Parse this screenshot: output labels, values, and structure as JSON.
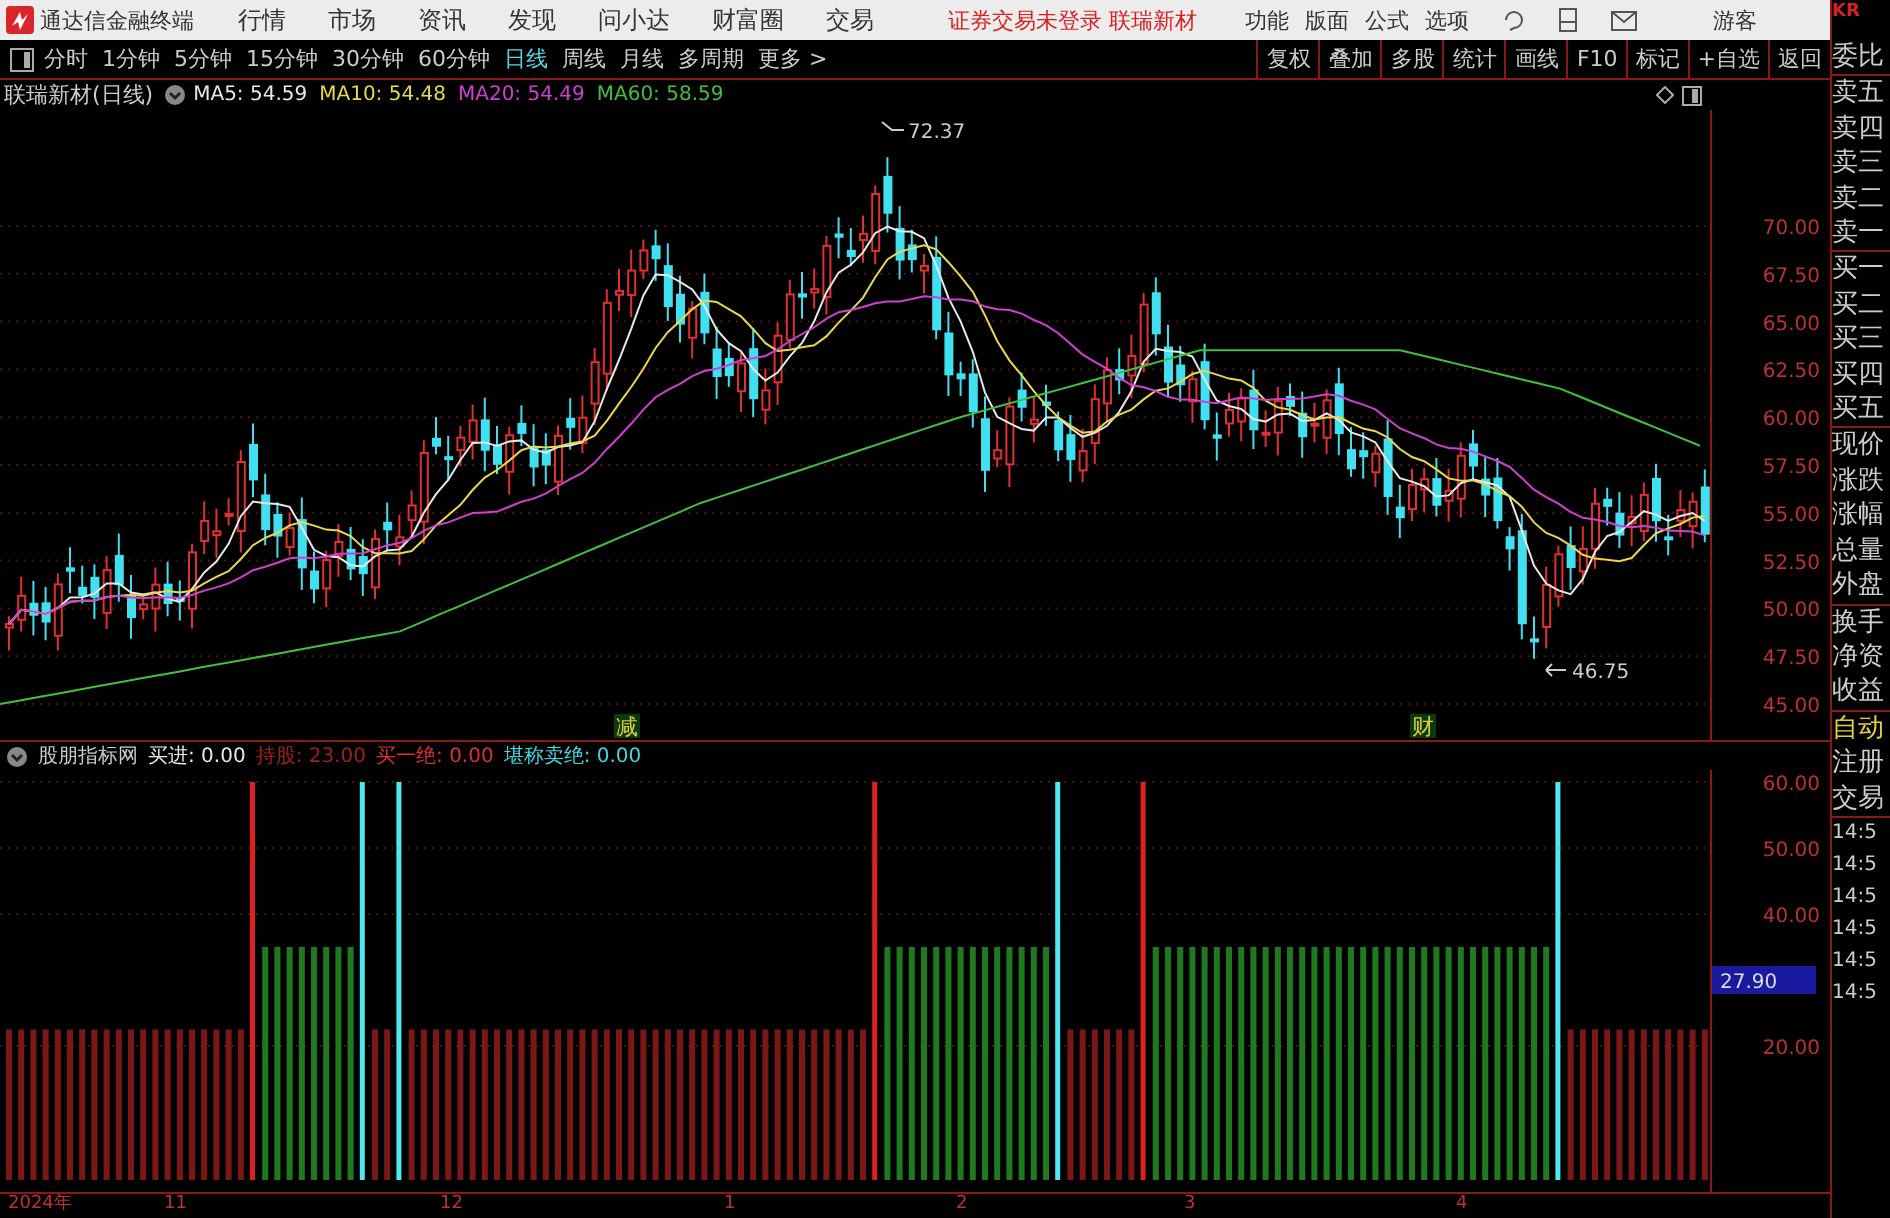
{
  "app": {
    "title": "通达信金融终端",
    "menu": [
      "行情",
      "市场",
      "资讯",
      "发现",
      "问小达",
      "财富圈",
      "交易"
    ],
    "notice": "证券交易未登录 联瑞新材",
    "tools": [
      "功能",
      "版面",
      "公式",
      "选项"
    ],
    "user": "游客"
  },
  "toolbar": {
    "periods": [
      {
        "label": "分时",
        "selected": false
      },
      {
        "label": "1分钟",
        "selected": false
      },
      {
        "label": "5分钟",
        "selected": false
      },
      {
        "label": "15分钟",
        "selected": false
      },
      {
        "label": "30分钟",
        "selected": false
      },
      {
        "label": "60分钟",
        "selected": false
      },
      {
        "label": "日线",
        "selected": true
      },
      {
        "label": "周线",
        "selected": false
      },
      {
        "label": "月线",
        "selected": false
      },
      {
        "label": "多周期",
        "selected": false
      },
      {
        "label": "更多 >",
        "selected": false
      }
    ],
    "actions": [
      "复权",
      "叠加",
      "多股",
      "统计",
      "画线",
      "F10",
      "标记",
      "+自选",
      "返回"
    ]
  },
  "chart": {
    "title": "联瑞新材(日线)",
    "ma": [
      {
        "label": "MA5: 54.59",
        "color": "#e8e8e8"
      },
      {
        "label": "MA10: 54.48",
        "color": "#e8d84a"
      },
      {
        "label": "MA20: 54.49",
        "color": "#d040d0"
      },
      {
        "label": "MA60: 58.59",
        "color": "#40c040"
      }
    ],
    "high_label": "72.37",
    "low_label": "46.75",
    "markers": [
      "减",
      "财"
    ],
    "yticks": [
      "70.00",
      "67.50",
      "65.00",
      "62.50",
      "60.00",
      "57.50",
      "55.00",
      "52.50",
      "50.00",
      "47.50",
      "45.00"
    ]
  },
  "indicator": {
    "name": "股朋指标网",
    "values": [
      {
        "label": "买进: 0.00",
        "color": "#e8e8e8"
      },
      {
        "label": "持股: 23.00",
        "color": "#a02020"
      },
      {
        "label": "买一绝: 0.00",
        "color": "#e03030"
      },
      {
        "label": "堪称卖绝: 0.00",
        "color": "#40d8e0"
      }
    ],
    "yticks": [
      "60.00",
      "50.00",
      "40.00",
      "20.00"
    ],
    "cursor_value": "27.90"
  },
  "date_axis": [
    "2024年",
    "11",
    "12",
    "1",
    "2",
    "3",
    "4"
  ],
  "side_panel": {
    "code": "KR",
    "quote_groups": [
      [
        "委比"
      ],
      [
        "卖五",
        "卖四",
        "卖三",
        "卖二",
        "卖一"
      ],
      [
        "买一",
        "买二",
        "买三",
        "买四",
        "买五"
      ],
      [
        "现价",
        "涨跌",
        "涨幅",
        "总量",
        "外盘"
      ],
      [
        "换手",
        "净资",
        "收益"
      ]
    ],
    "actions": [
      "自动",
      "注册",
      "交易"
    ],
    "times": [
      "14:5",
      "14:5",
      "14:5",
      "14:5",
      "14:5",
      "14:5"
    ]
  }
}
